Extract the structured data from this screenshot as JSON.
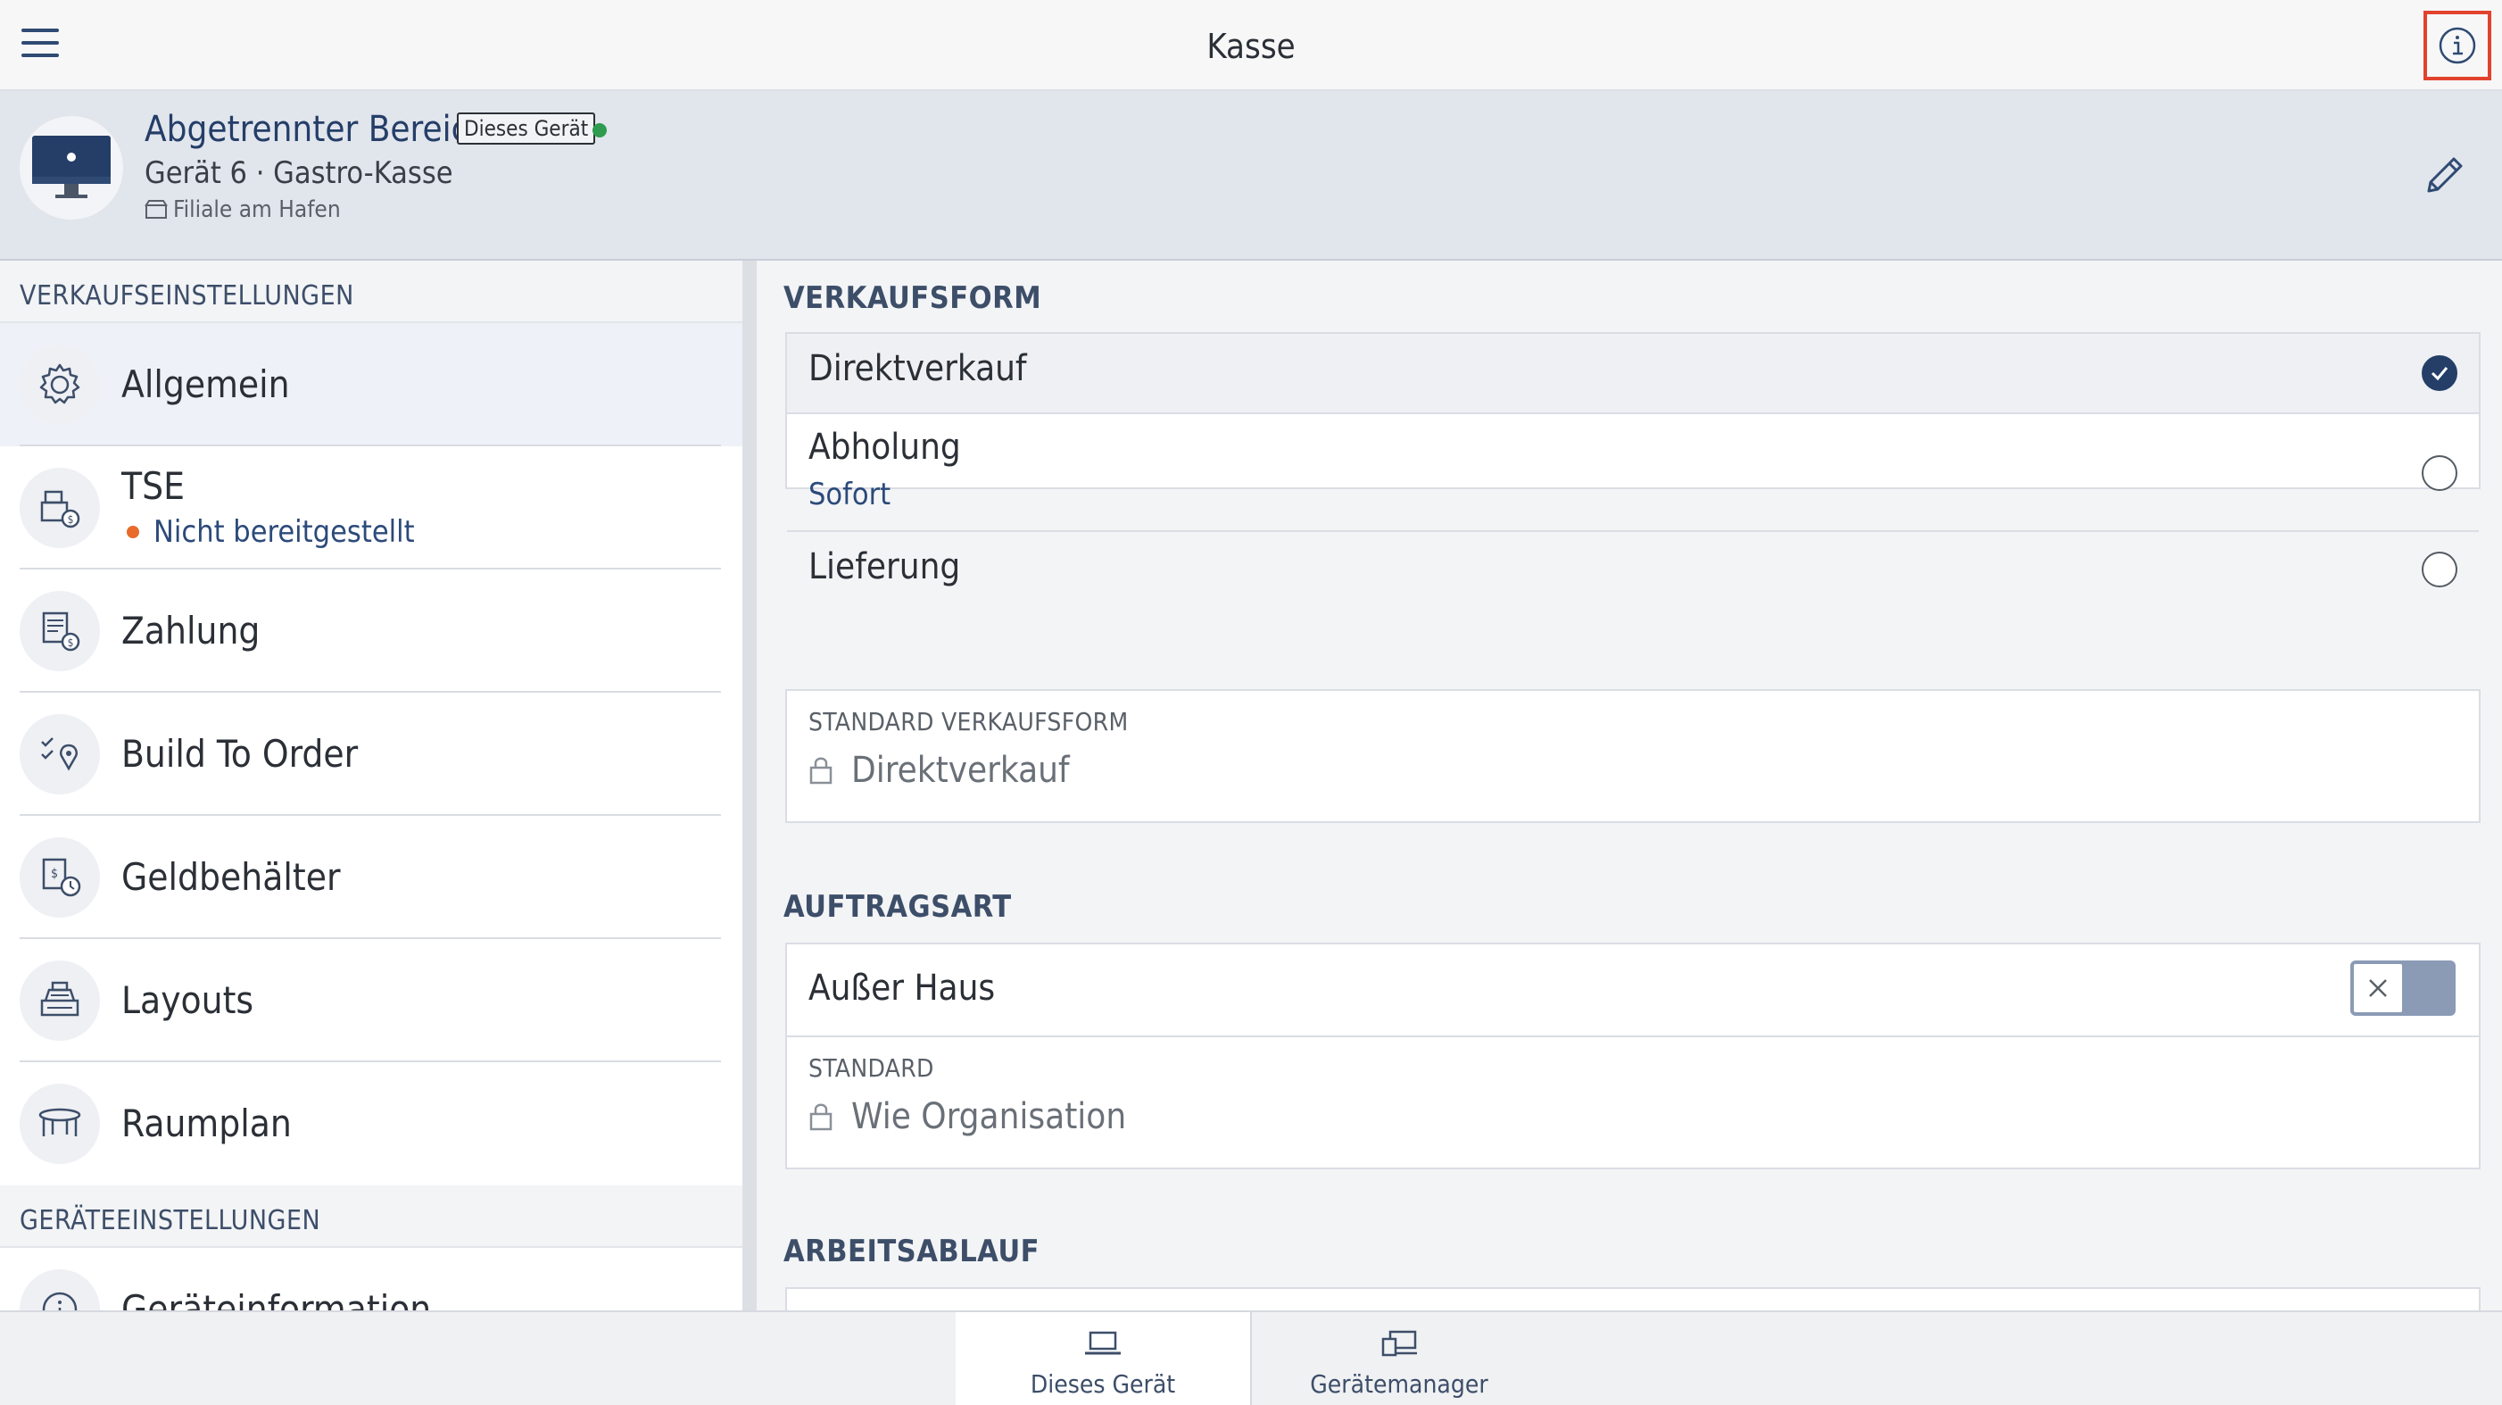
{
  "app": {
    "title": "Kasse"
  },
  "device": {
    "name": "Abgetrennter Bereich",
    "badge": "Dieses Gerät",
    "status_color": "#2e9b4f",
    "subtitle": "Gerät 6 · Gastro-Kasse",
    "branch": "Filiale am Hafen"
  },
  "sidebar": {
    "section1": "VERKAUFSEINSTELLUNGEN",
    "items": [
      {
        "label": "Allgemein",
        "icon": "gear-icon",
        "active": true
      },
      {
        "label": "TSE",
        "status": "Nicht bereitgestellt",
        "icon": "tse-icon"
      },
      {
        "label": "Zahlung",
        "icon": "payment-icon"
      },
      {
        "label": "Build To Order",
        "icon": "build-to-order-icon"
      },
      {
        "label": "Geldbehälter",
        "icon": "cash-drawer-icon"
      },
      {
        "label": "Layouts",
        "icon": "register-layout-icon"
      },
      {
        "label": "Raumplan",
        "icon": "table-icon"
      }
    ],
    "section2": "GERÄTEEINSTELLUNGEN",
    "items2": [
      {
        "label": "Geräteinformation",
        "icon": "info-icon"
      }
    ]
  },
  "main": {
    "verkaufsform": {
      "title": "VERKAUFSFORM",
      "options": [
        {
          "label": "Direktverkauf",
          "selected": true
        },
        {
          "label": "Abholung",
          "sublabel": "Sofort",
          "selected": false
        },
        {
          "label": "Lieferung",
          "selected": false
        }
      ],
      "default_label": "STANDARD VERKAUFSFORM",
      "default_value": "Direktverkauf"
    },
    "auftragsart": {
      "title": "AUFTRAGSART",
      "option_label": "Außer Haus",
      "toggle_on": false,
      "default_label": "STANDARD",
      "default_value": "Wie Organisation"
    },
    "arbeitsablauf": {
      "title": "ARBEITSABLAUF"
    }
  },
  "tabbar": {
    "tabs": [
      {
        "label": "Dieses Gerät",
        "active": true
      },
      {
        "label": "Gerätemanager",
        "active": false
      }
    ]
  },
  "colors": {
    "accent": "#243e68",
    "highlight": "#e2422e",
    "warning_dot": "#e86a2c"
  }
}
